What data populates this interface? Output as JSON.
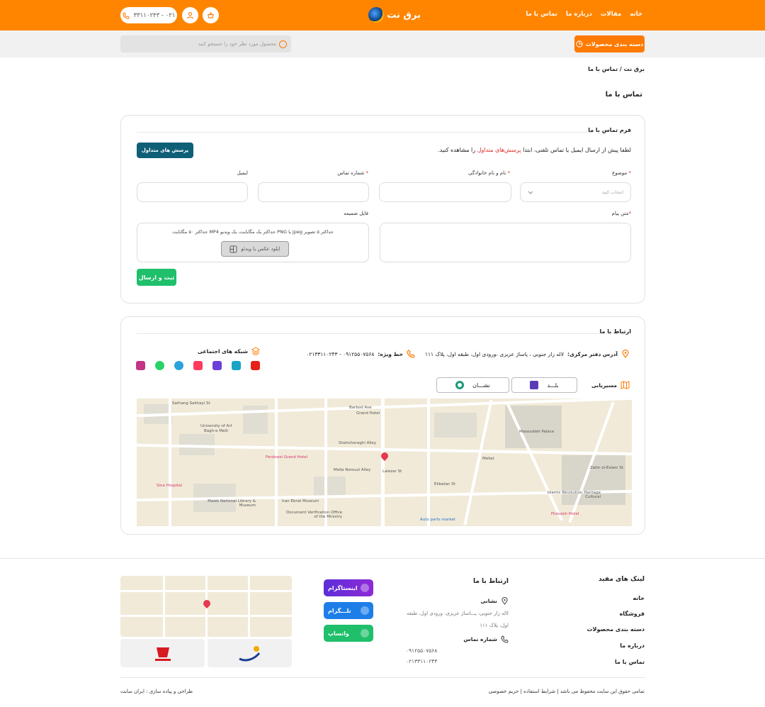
{
  "header": {
    "nav": [
      "خانه",
      "مقالات",
      "درباره ما",
      "تماس با ما"
    ],
    "logo_text": "برق نت",
    "phone": "۰۲۱ - ۳۳۱۱۰۲۴۳"
  },
  "searchbar": {
    "category_button": "دسته بندی محصولات",
    "search_placeholder": "محصول مورد نظر خود را جستجو کنید"
  },
  "breadcrumb": "برق نت / تماس با ما",
  "page_title": "تماس با ما",
  "form": {
    "title": "فرم تماس با ما",
    "note_before": "لطفا پیش از ارسال ایمیل یا تماس تلفنی، ابتدا",
    "note_link": "پرسش‌های متداول",
    "note_after": "را مشاهده کنید.",
    "faq_button": "پرسش های متداول",
    "subject_label": "موضوع",
    "subject_placeholder": "انتخاب کنید",
    "name_label": "نام و نام خانوادگی",
    "phone_label": "شماره تماس",
    "email_label": "ایمیل",
    "message_label": "متن پیام",
    "attachment_label": "فایل ضمیمه",
    "attachment_hint": "حداکثر ۵ تصویر jpeg یا PNG حداکثر یک مگابایت، یک ویدیو MP4 حداکثر ۵۰ مگابایت",
    "upload_button": "اپلود عکس یا ویدئو",
    "submit_button": "ثبت و ارسال"
  },
  "contact": {
    "title": "ارتباط با ما",
    "address_label": "آدرس دفتر مرکزی:",
    "address": "لاله زار جنوبی ، پاساژ عزیزی ،ورودی اول، طبقه اول، پلاک ۱۱۱",
    "hotline_label": "خط ویژه:",
    "hotline": "۰۹۱۲۵۵۰۷۵۶۸ - ۰۲۱۳۳۱۱۰۲۴۳",
    "social_title": "شبکه های اجتماعی",
    "routing_label": "مسیریابی",
    "balad": "بلـــد",
    "neshan": "نشـــان",
    "social_icon_colors": [
      "#e62117",
      "#1aa3c2",
      "#6c3fd6",
      "#ff3b5c",
      "#2aa3dd",
      "#25d366",
      "#c13584"
    ]
  },
  "map": {
    "labels": [
      "Sarhang Sakhayi St",
      "University of Art",
      "Bagh-e Melli",
      "Barbod Ave",
      "Grand Hotel",
      "Shahcheraghi Alley",
      "Ferdowsi Grand Hotel",
      "Molla Norouzi Alley",
      "Sina Hospital",
      "Malek National Library & Museum",
      "Iran Ebrat Museum",
      "Document Verification Office of the Ministry",
      "Masoudieh Palace",
      "Mellat",
      "Ekbatan St",
      "Firouzeh Hotel",
      "Islamic Revolution Heritage Cultural",
      "Zahir ol-Eslam St",
      "Auto parts market",
      "Lalezar St"
    ]
  },
  "footer": {
    "links_title": "لینک های مفید",
    "links": [
      "خانه",
      "فروشگاه",
      "دسته بندی محصولات",
      "درباره ما",
      "تماس با ما"
    ],
    "contact_title": "ارتباط با ما",
    "address_title": "نشانی",
    "address": "لاله زار جنوبی، پـــاساژ عزیزی، ورودی اول، طبقه اول، پلاک ۱۱۱",
    "phone_title": "شماره تماس",
    "phones": [
      "۰۹۱۲۵۵۰۷۵۶۸",
      "۰۲۱۳۳۱۱۰۲۴۳"
    ],
    "instagram": "اینستاگرام",
    "telegram": "تلـــگرام",
    "whatsapp": "واتساپ",
    "copyright": "تمامی حقوق این سایت محفوظ می باشد | شرایط استفاده | حریم خصوصی",
    "credit": "طراحی و پیاده سازی : ایران سایت"
  }
}
